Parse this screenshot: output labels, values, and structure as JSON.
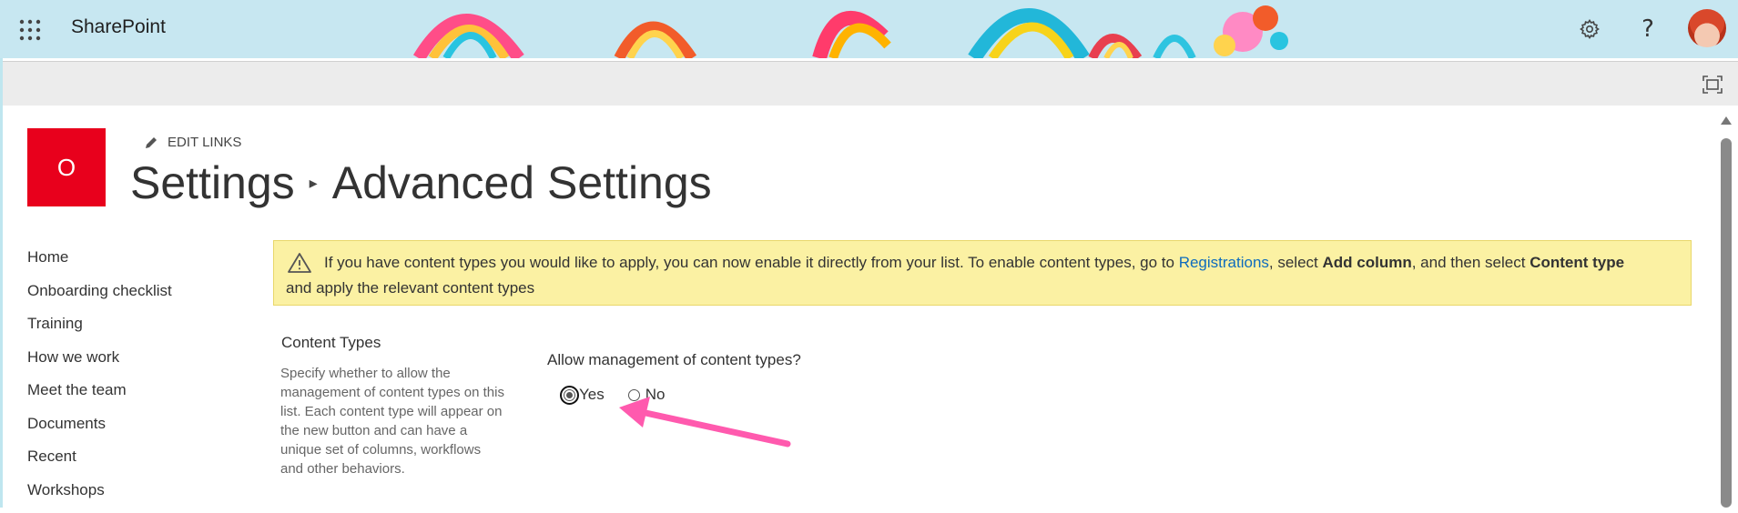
{
  "suite": {
    "app_name": "SharePoint",
    "waffle_icon": "app-launcher-icon",
    "settings_icon": "gear-icon",
    "help_label": "?"
  },
  "ribbon": {
    "focus_icon": "focus-mode-icon"
  },
  "site": {
    "logo_letter": "O",
    "logo_color": "#e8001c",
    "edit_links_label": "EDIT LINKS",
    "breadcrumb": [
      "Settings",
      "Advanced Settings"
    ]
  },
  "nav": {
    "items": [
      "Home",
      "Onboarding checklist",
      "Training",
      "How we work",
      "Meet the team",
      "Documents",
      "Recent",
      "Workshops"
    ]
  },
  "banner": {
    "text_before_link": "If you have content types you would like to apply, you can now enable it directly from your list. To enable content types, go to ",
    "link": "Registrations",
    "text_after_link": ", select ",
    "bold1": "Add column",
    "text_mid": ", and then select ",
    "bold2": "Content type",
    "line2": "and apply the relevant content types",
    "link_color": "#0f6cbd",
    "background": "#fbf1a3"
  },
  "content_types": {
    "title": "Content Types",
    "description": "Specify whether to allow the management of content types on this list. Each content type will appear on the new button and can have a unique set of columns, workflows and other behaviors.",
    "question": "Allow management of content types?",
    "options": [
      {
        "label": "Yes",
        "selected": true
      },
      {
        "label": "No",
        "selected": false
      }
    ]
  },
  "annotation": {
    "arrow_color": "#ff5aae"
  }
}
